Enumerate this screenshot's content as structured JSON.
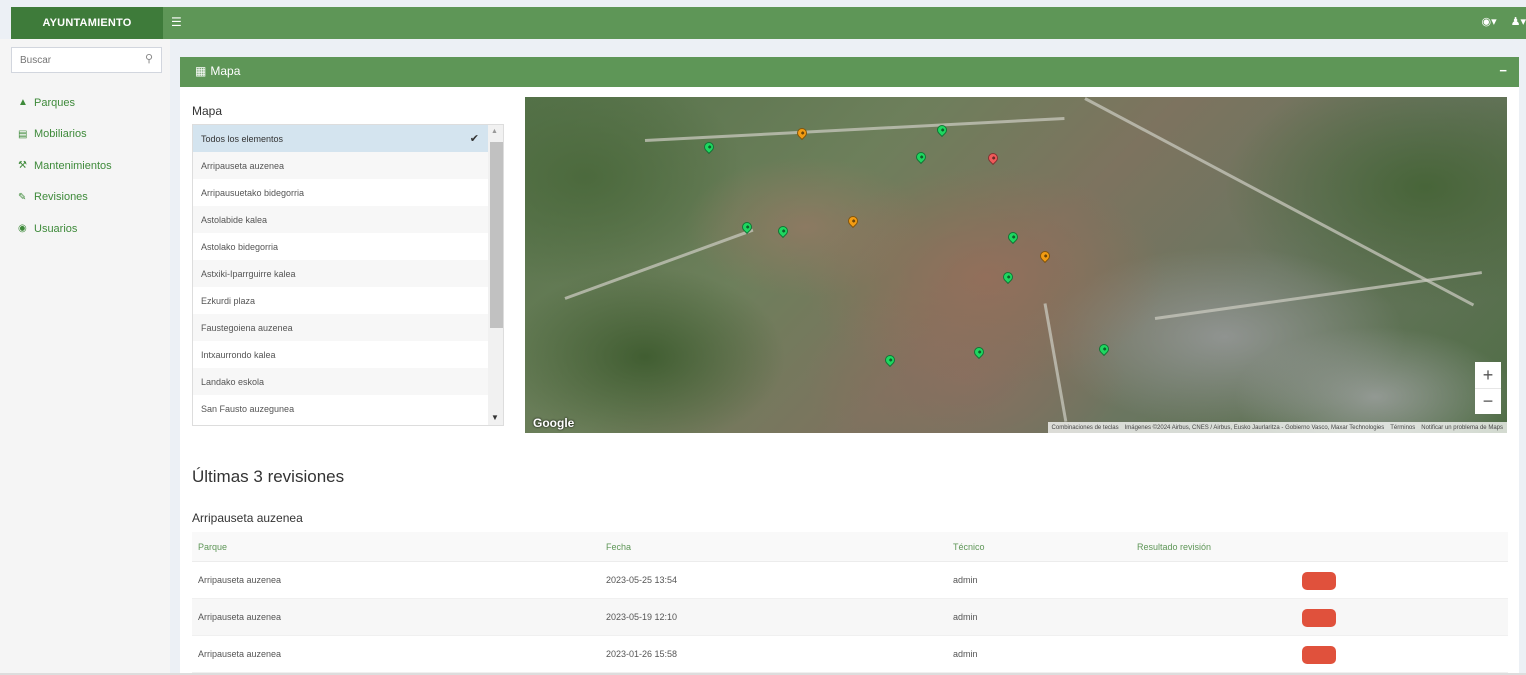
{
  "header": {
    "brand": "AYUNTAMIENTO",
    "menu_icon": "hamburger-icon",
    "right_icons": [
      "language-icon",
      "user-icon"
    ]
  },
  "sidebar": {
    "search_placeholder": "Buscar",
    "items": [
      {
        "label": "Parques",
        "icon": "tree-icon"
      },
      {
        "label": "Mobiliarios",
        "icon": "bank-icon"
      },
      {
        "label": "Mantenimientos",
        "icon": "wrench-icon"
      },
      {
        "label": "Revisiones",
        "icon": "edit-icon"
      },
      {
        "label": "Usuarios",
        "icon": "user-circle-icon"
      }
    ]
  },
  "box": {
    "title": "Mapa",
    "collapse_label": "−"
  },
  "map_panel": {
    "label": "Mapa",
    "items": [
      "Todos los elementos",
      "Arripauseta auzenea",
      "Arripausuetako bidegorria",
      "Astolabide kalea",
      "Astolako bidegorria",
      "Astxiki-Iparrguirre kalea",
      "Ezkurdi plaza",
      "Faustegoiena auzenea",
      "Intxaurrondo kalea",
      "Landako eskola",
      "San Fausto auzegunea"
    ],
    "selected": "Todos los elementos"
  },
  "map": {
    "logo": "Google",
    "zoom_in": "+",
    "zoom_out": "−",
    "attribution": {
      "shortcuts": "Combinaciones de teclas",
      "imagery": "Imágenes ©2024 Airbus, CNES / Airbus, Eusko Jaurlaritza - Gobierno Vasco, Maxar Technologies",
      "terms": "Términos",
      "report": "Notificar un problema de Maps"
    },
    "marker_colors": {
      "green": "#1ed760",
      "orange": "#f39c12",
      "red": "#f05a5a"
    }
  },
  "revisions": {
    "title": "Últimas 3 revisiones",
    "park_name": "Arripauseta auzenea",
    "columns": [
      "Parque",
      "Fecha",
      "Técnico",
      "Resultado revisión"
    ],
    "rows": [
      {
        "park": "Arripauseta auzenea",
        "date": "2023-05-25 13:54",
        "tech": "admin",
        "result_color": "#e0513c"
      },
      {
        "park": "Arripauseta auzenea",
        "date": "2023-05-19 12:10",
        "tech": "admin",
        "result_color": "#e0513c"
      },
      {
        "park": "Arripauseta auzenea",
        "date": "2023-01-26 15:58",
        "tech": "admin",
        "result_color": "#e0513c"
      }
    ]
  },
  "colors": {
    "brand": "#3e7b3a",
    "topbar": "#5e9657",
    "accent": "#3e8a3a",
    "danger": "#e0513c"
  }
}
